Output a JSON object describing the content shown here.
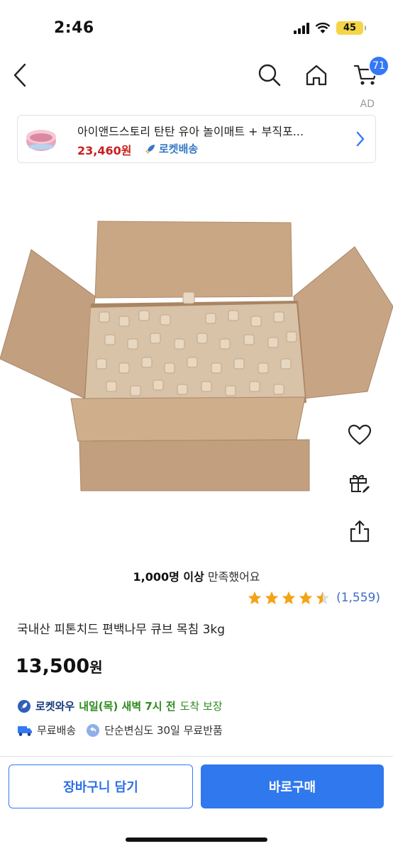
{
  "status_bar": {
    "time": "2:46",
    "battery": "45"
  },
  "nav": {
    "cart_count": "71",
    "ad_label": "AD"
  },
  "ad_banner": {
    "title": "아이앤드스토리 탄탄 유아 놀이매트 + 부직포...",
    "price": "23,460원",
    "delivery": "로켓배송"
  },
  "product": {
    "satisfaction_bold": "1,000명 이상",
    "satisfaction_rest": " 만족했어요",
    "rating": 4.5,
    "review_count": "(1,559)",
    "title": "국내산 피톤치드 편백나무 큐브 목침 3kg",
    "price": "13,500",
    "price_unit": "원"
  },
  "delivery": {
    "badge": "로켓와우",
    "date": "내일(목) 새벽 7시 전",
    "suffix": "도착 보장"
  },
  "shipping": {
    "free_shipping": "무료배송",
    "return_policy": "단순변심도 30일 무료반품"
  },
  "buttons": {
    "add_to_cart": "장바구니 담기",
    "buy_now": "바로구매"
  },
  "colors": {
    "accent": "#2f78ee",
    "price_red": "#c8201f",
    "green": "#2e8b1e"
  }
}
